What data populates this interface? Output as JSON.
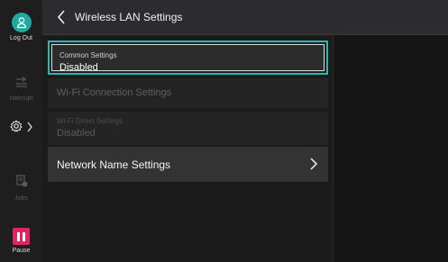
{
  "header": {
    "title": "Wireless LAN Settings",
    "back_icon": "chevron-left-icon"
  },
  "rail": {
    "logout_label": "Log Out",
    "interrupt_label": "Interrupt",
    "jobs_label": "Jobs",
    "pause_label": "Pause"
  },
  "items": {
    "common": {
      "label": "Common Settings",
      "value": "Disabled"
    },
    "wifi": {
      "label": "Wi-Fi Connection Settings"
    },
    "direct": {
      "label": "Wi-Fi Direct Settings",
      "value": "Disabled"
    },
    "network": {
      "label": "Network Name Settings"
    }
  },
  "colors": {
    "accent": "#29b9b1",
    "logout": "#1fa9a2",
    "pause": "#e0245e"
  }
}
